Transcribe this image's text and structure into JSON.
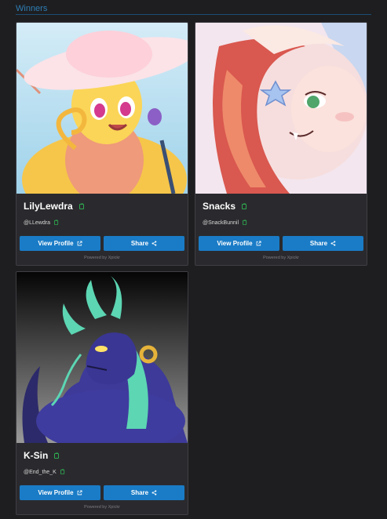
{
  "section": {
    "title": "Winners"
  },
  "cards": [
    {
      "name": "LilyLewdra",
      "handle": "@LLewdra",
      "view_label": "View Profile",
      "share_label": "Share",
      "powered_by": "Powered by Xpickr",
      "art_subject": "yellow-creature-with-sun-hat"
    },
    {
      "name": "Snacks",
      "handle": "@SnackBunnil",
      "view_label": "View Profile",
      "share_label": "Share",
      "powered_by": "Powered by Xpickr",
      "art_subject": "red-haired-character-with-star-clip"
    },
    {
      "name": "K-Sin",
      "handle": "@End_the_K",
      "view_label": "View Profile",
      "share_label": "Share",
      "powered_by": "Powered by Xpickr",
      "art_subject": "purple-dragon"
    }
  ],
  "colors": {
    "background": "#1e1e20",
    "card": "#2a2a2e",
    "button": "#1a7cc7",
    "copy_icon": "#2ea84f",
    "section_title": "#2e7eb5"
  },
  "icons": {
    "copy": "copy-icon",
    "external_link": "external-link-icon",
    "share": "share-icon"
  }
}
